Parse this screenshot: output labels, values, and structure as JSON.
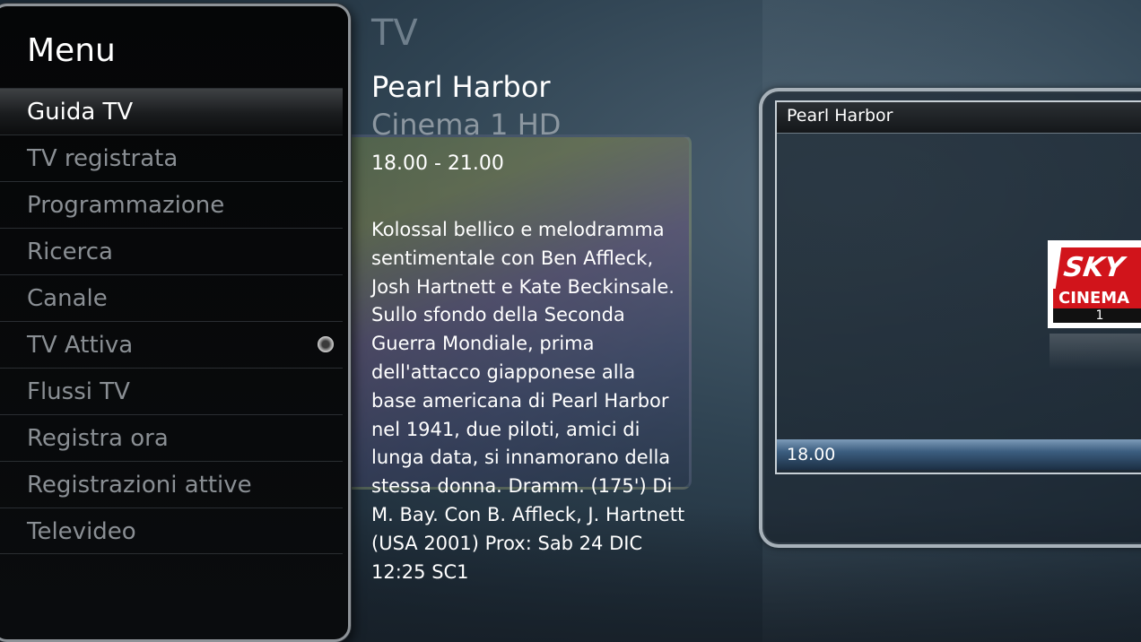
{
  "menu": {
    "title": "Menu",
    "items": [
      {
        "label": "Guida TV",
        "selected": true
      },
      {
        "label": "TV registrata",
        "selected": false
      },
      {
        "label": "Programmazione",
        "selected": false
      },
      {
        "label": "Ricerca",
        "selected": false
      },
      {
        "label": "Canale",
        "selected": false
      },
      {
        "label": "TV Attiva",
        "selected": false,
        "indicator": "dot-icon"
      },
      {
        "label": "Flussi TV",
        "selected": false
      },
      {
        "label": "Registra ora",
        "selected": false
      },
      {
        "label": "Registrazioni attive",
        "selected": false
      },
      {
        "label": "Televideo",
        "selected": false
      }
    ]
  },
  "section_title": "TV",
  "program": {
    "title": "Pearl Harbor",
    "channel": "Cinema 1 HD",
    "time_range": "18.00 - 21.00",
    "description": "Kolossal bellico e melodramma sentimentale con Ben Affleck, Josh Hartnett e Kate Beckinsale. Sullo sfondo della Seconda Guerra Mondiale, prima dell'attacco giapponese alla base americana di Pearl Harbor nel 1941, due piloti, amici di lunga data, si innamorano della stessa donna. Dramm. (175') Di M. Bay. Con B. Affleck, J. Hartnett (USA 2001) Prox: Sab 24 DIC 12:25 SC1"
  },
  "preview": {
    "title": "Pearl Harbor",
    "time": "18.00",
    "logo": {
      "line1": "SKY",
      "line2": "CINEMA",
      "line3": "1"
    }
  },
  "colors": {
    "accent_red": "#d1141b",
    "menu_bg": "#050607",
    "text_dim": "#8a8f94",
    "section_title": "#6f7f8c"
  }
}
